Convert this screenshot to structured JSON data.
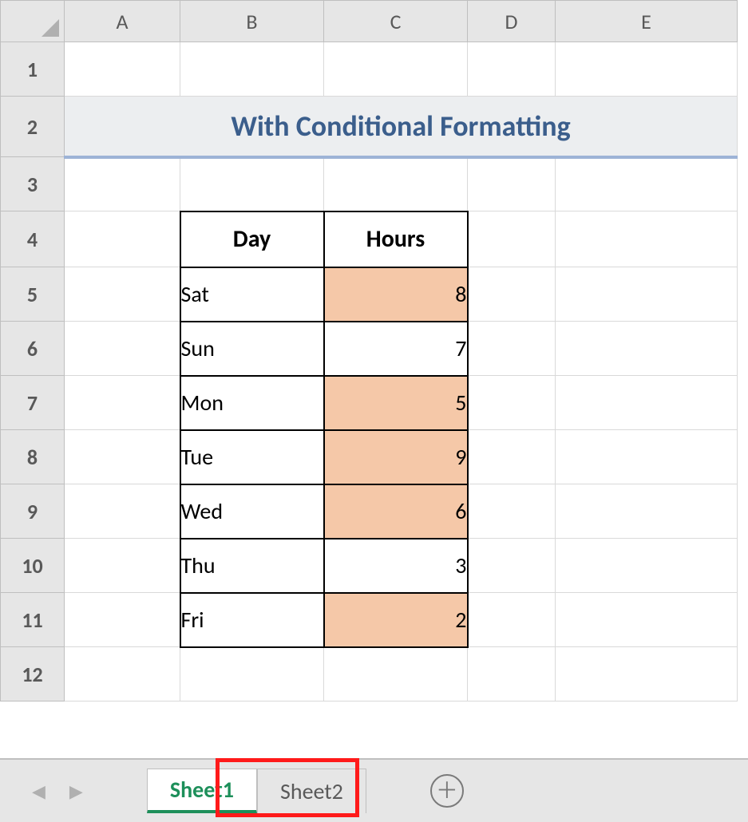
{
  "columns": [
    "A",
    "B",
    "C",
    "D",
    "E"
  ],
  "rows": [
    "1",
    "2",
    "3",
    "4",
    "5",
    "6",
    "7",
    "8",
    "9",
    "10",
    "11",
    "12"
  ],
  "title": "With Conditional Formatting",
  "table": {
    "headers": {
      "day": "Day",
      "hours": "Hours"
    },
    "rows": [
      {
        "day": "Sat",
        "hours": "8",
        "highlight": true
      },
      {
        "day": "Sun",
        "hours": "7",
        "highlight": false
      },
      {
        "day": "Mon",
        "hours": "5",
        "highlight": true
      },
      {
        "day": "Tue",
        "hours": "9",
        "highlight": true
      },
      {
        "day": "Wed",
        "hours": "6",
        "highlight": true
      },
      {
        "day": "Thu",
        "hours": "3",
        "highlight": false
      },
      {
        "day": "Fri",
        "hours": "2",
        "highlight": true
      }
    ]
  },
  "sheets": {
    "active": "Sheet1",
    "list": [
      "Sheet1",
      "Sheet2"
    ]
  },
  "colors": {
    "highlight": "#f5c8a8",
    "title_text": "#3b5e8c",
    "title_underline": "#9db3d6",
    "active_tab": "#1d8f5a",
    "annotation": "#ff1a1a"
  }
}
